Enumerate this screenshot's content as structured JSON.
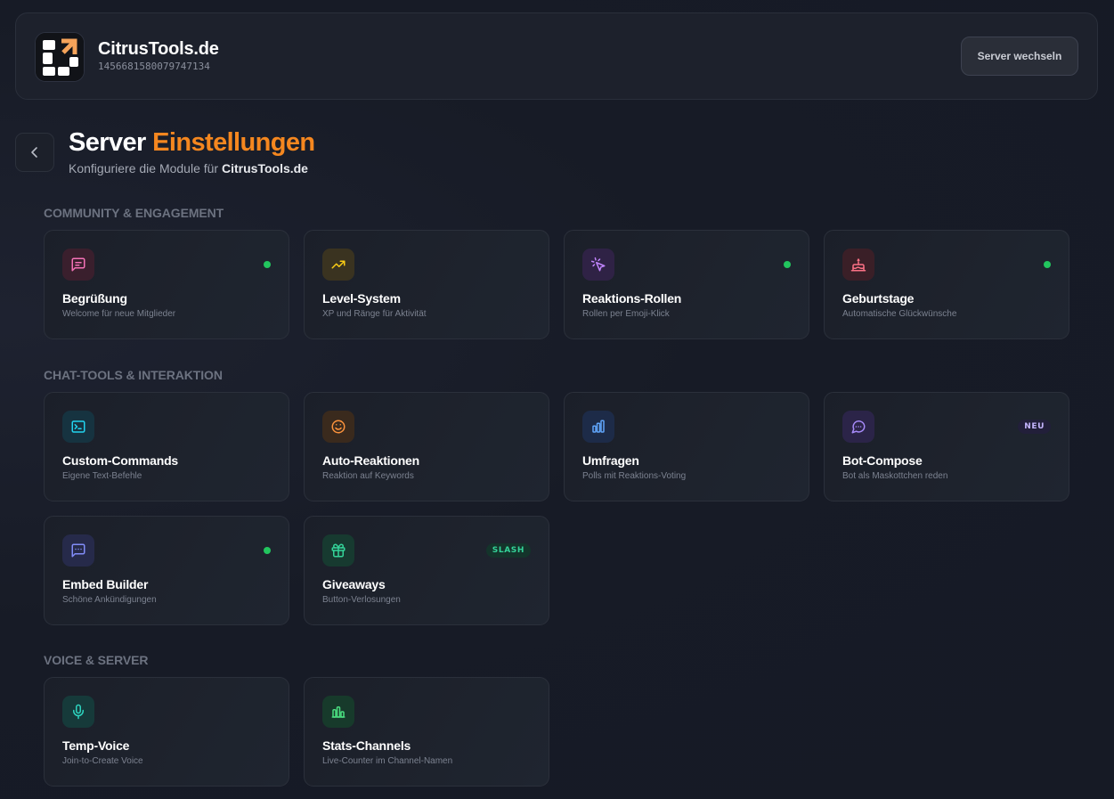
{
  "header": {
    "server_name": "CitrusTools.de",
    "server_id": "1456681580079747134",
    "switch_label": "Server wechseln"
  },
  "page": {
    "title_main": "Server",
    "title_accent": "Einstellungen",
    "subtitle_prefix": "Konfiguriere die Module für",
    "subtitle_server": "CitrusTools.de"
  },
  "colors": {
    "accent": "#f5871f",
    "active_dot": "#22c55e"
  },
  "sections": [
    {
      "title": "COMMUNITY & ENGAGEMENT",
      "cards": [
        {
          "name": "Begrüßung",
          "desc": "Welcome für neue Mitglieder",
          "icon": "message-square-icon",
          "active": true
        },
        {
          "name": "Level-System",
          "desc": "XP und Ränge für Aktivität",
          "icon": "trending-up-icon",
          "active": false
        },
        {
          "name": "Reaktions-Rollen",
          "desc": "Rollen per Emoji-Klick",
          "icon": "mouse-pointer-click-icon",
          "active": true
        },
        {
          "name": "Geburtstage",
          "desc": "Automatische Glückwünsche",
          "icon": "cake-icon",
          "active": true
        }
      ]
    },
    {
      "title": "CHAT-TOOLS & INTERAKTION",
      "cards": [
        {
          "name": "Custom-Commands",
          "desc": "Eigene Text-Befehle",
          "icon": "terminal-icon",
          "active": false
        },
        {
          "name": "Auto-Reaktionen",
          "desc": "Reaktion auf Keywords",
          "icon": "smile-icon",
          "active": false
        },
        {
          "name": "Umfragen",
          "desc": "Polls mit Reaktions-Voting",
          "icon": "bar-chart-icon",
          "active": false
        },
        {
          "name": "Bot-Compose",
          "desc": "Bot als Maskottchen reden",
          "icon": "message-circle-icon",
          "active": false,
          "badge": "NEU"
        },
        {
          "name": "Embed Builder",
          "desc": "Schöne Ankündigungen",
          "icon": "message-square-more-icon",
          "active": true
        },
        {
          "name": "Giveaways",
          "desc": "Button-Verlosungen",
          "icon": "gift-icon",
          "active": false,
          "badge": "SLASH"
        }
      ]
    },
    {
      "title": "VOICE & SERVER",
      "cards": [
        {
          "name": "Temp-Voice",
          "desc": "Join-to-Create Voice",
          "icon": "mic-icon",
          "active": false
        },
        {
          "name": "Stats-Channels",
          "desc": "Live-Counter im Channel-Namen",
          "icon": "stats-bars-icon",
          "active": false
        }
      ]
    }
  ]
}
